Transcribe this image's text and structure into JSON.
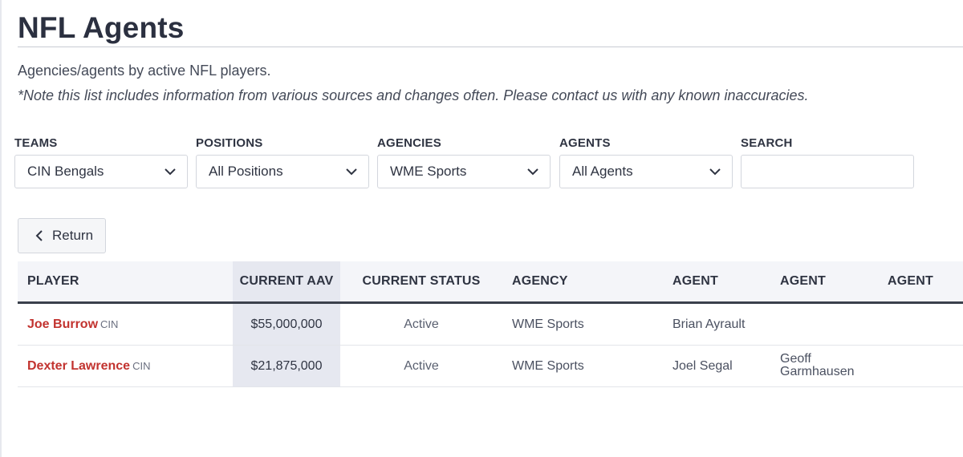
{
  "page": {
    "title": "NFL Agents",
    "subtitle": "Agencies/agents by active NFL players.",
    "note": "*Note this list includes information from various sources and changes often. Please contact us with any known inaccuracies."
  },
  "filters": {
    "teams": {
      "label": "TEAMS",
      "value": "CIN Bengals"
    },
    "positions": {
      "label": "POSITIONS",
      "value": "All Positions"
    },
    "agencies": {
      "label": "AGENCIES",
      "value": "WME Sports"
    },
    "agents": {
      "label": "AGENTS",
      "value": "All Agents"
    },
    "search": {
      "label": "SEARCH",
      "value": "",
      "placeholder": ""
    }
  },
  "return_button": {
    "label": "Return",
    "icon": "chevron-left-icon"
  },
  "table": {
    "headers": [
      "PLAYER",
      "CURRENT AAV",
      "CURRENT STATUS",
      "AGENCY",
      "AGENT",
      "AGENT",
      "AGENT"
    ],
    "rows": [
      {
        "player": "Joe Burrow",
        "team": "CIN",
        "aav": "$55,000,000",
        "status": "Active",
        "agency": "WME Sports",
        "agent1": "Brian Ayrault",
        "agent2": "",
        "agent3": ""
      },
      {
        "player": "Dexter Lawrence",
        "team": "CIN",
        "aav": "$21,875,000",
        "status": "Active",
        "agency": "WME Sports",
        "agent1": "Joel Segal",
        "agent2": "Geoff Garmhausen",
        "agent3": ""
      }
    ]
  },
  "colors": {
    "player_link": "#c2332f",
    "header_rule": "#3b404c",
    "aav_column_bg": "#e6e8f0"
  }
}
